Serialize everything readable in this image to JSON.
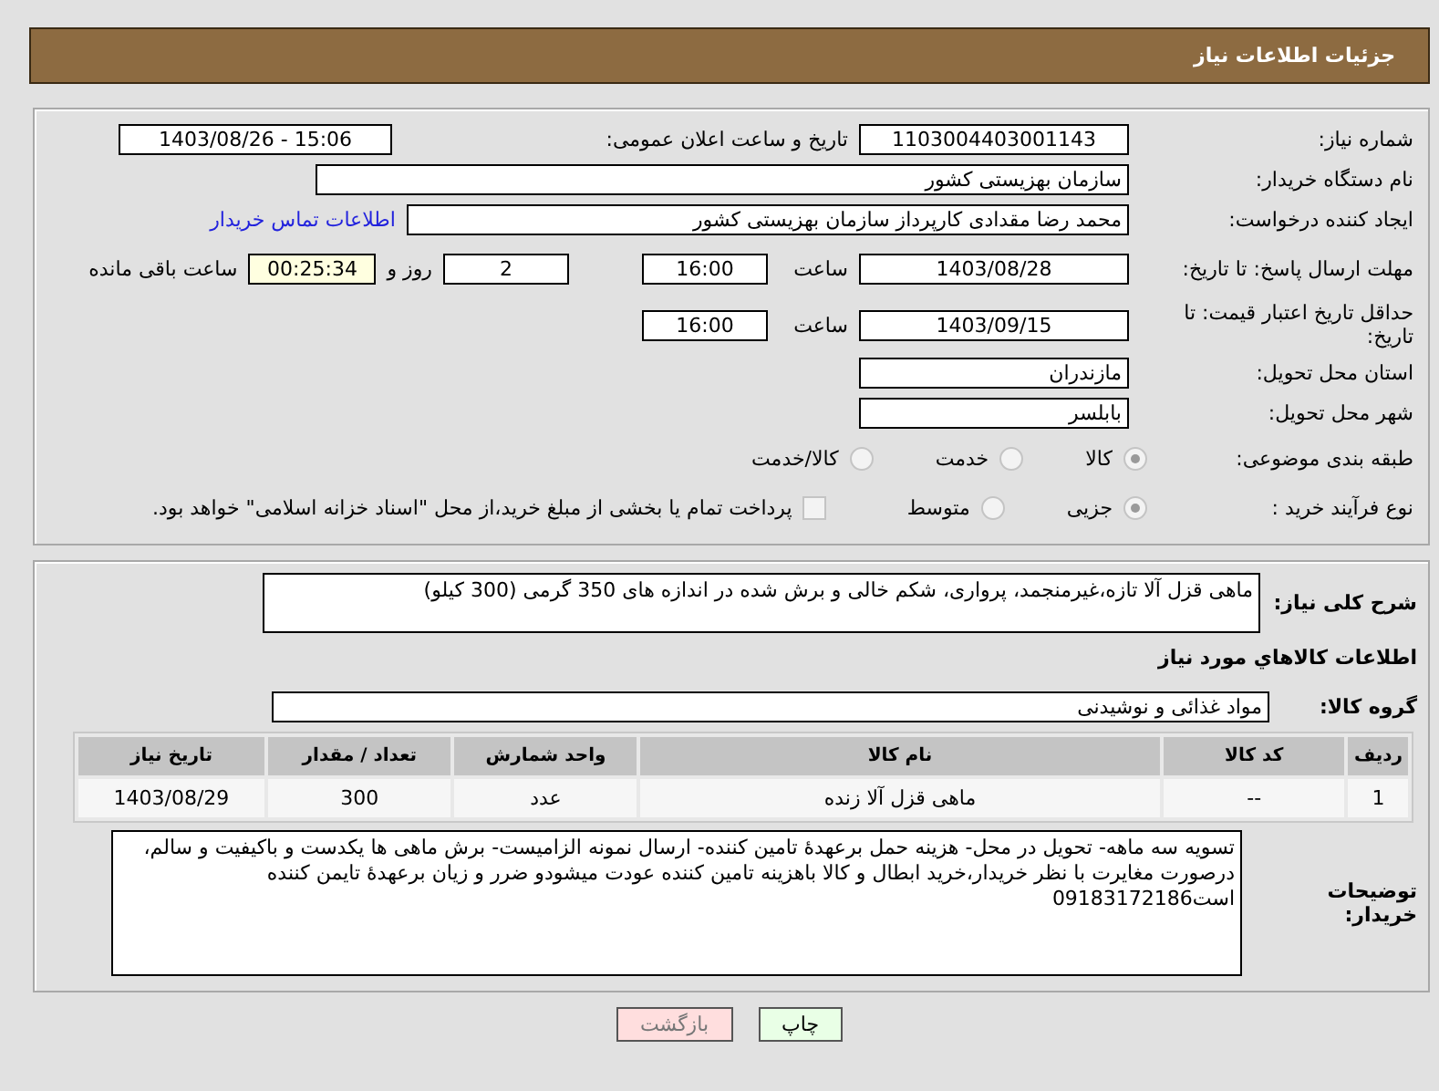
{
  "header": {
    "title": "جزئیات اطلاعات نیاز"
  },
  "need_number": {
    "label": "شماره نیاز:",
    "value": "1103004403001143"
  },
  "announce": {
    "label": "تاریخ و ساعت اعلان عمومی:",
    "value": "1403/08/26 - 15:06"
  },
  "buyer_org": {
    "label": "نام دستگاه خریدار:",
    "value": "سازمان بهزیستی کشور"
  },
  "requester": {
    "label": "ایجاد کننده درخواست:",
    "value": "محمد رضا  مقدادی کارپرداز سازمان بهزیستی کشور",
    "link": "اطلاعات تماس خریدار"
  },
  "reply_deadline": {
    "label": "مهلت ارسال پاسخ: تا تاریخ:",
    "date": "1403/08/28",
    "time_label": "ساعت",
    "time": "16:00",
    "days": "2",
    "days_label": "روز و",
    "remaining": "00:25:34",
    "remaining_label": "ساعت باقی مانده"
  },
  "price_validity": {
    "label": "حداقل تاریخ اعتبار قیمت: تا تاریخ:",
    "date": "1403/09/15",
    "time_label": "ساعت",
    "time": "16:00"
  },
  "province": {
    "label": "استان محل تحویل:",
    "value": "مازندران"
  },
  "city": {
    "label": "شهر محل تحویل:",
    "value": "بابلسر"
  },
  "category": {
    "label": "طبقه بندی موضوعی:",
    "options": [
      {
        "label": "کالا",
        "selected": true
      },
      {
        "label": "خدمت",
        "selected": false
      },
      {
        "label": "کالا/خدمت",
        "selected": false
      }
    ]
  },
  "purchase_type": {
    "label": "نوع فرآیند خرید :",
    "options": [
      {
        "label": "جزیی",
        "selected": true
      },
      {
        "label": "متوسط",
        "selected": false
      }
    ],
    "checkbox": {
      "checked": false,
      "label": "پرداخت تمام یا بخشی از مبلغ خرید،از محل \"اسناد خزانه اسلامی\" خواهد بود."
    }
  },
  "description": {
    "label": "شرح کلی نیاز:",
    "value": "ماهی قزل آلا تازه،غیرمنجمد، پرواری، شکم خالی و برش شده در اندازه های 350 گرمی (300 کیلو)"
  },
  "goods_title": "اطلاعات کالاهاي مورد نياز",
  "goods_group": {
    "label": "گروه کالا:",
    "value": "مواد غذائی و نوشیدنی"
  },
  "table": {
    "columns": [
      "ردیف",
      "کد کالا",
      "نام کالا",
      "واحد شمارش",
      "تعداد / مقدار",
      "تاریخ نیاز"
    ],
    "rows": [
      [
        "1",
        "--",
        "ماهی قزل آلا زنده",
        "عدد",
        "300",
        "1403/08/29"
      ]
    ]
  },
  "buyer_notes": {
    "label": "توضیحات خریدار:",
    "value": "تسویه سه ماهه- تحویل در محل- هزینه حمل برعهدۀ تامین کننده- ارسال نمونه الزامیست- برش ماهی ها یکدست و باکیفیت و سالم، درصورت مغایرت با نظر خریدار،خرید ابطال و کالا باهزینه تامین کننده عودت میشودو ضرر و زیان برعهدۀ تایمن کننده است09183172186"
  },
  "buttons": [
    {
      "label": "چاپ",
      "kind": "print"
    },
    {
      "label": "بازگشت",
      "kind": "back"
    }
  ]
}
